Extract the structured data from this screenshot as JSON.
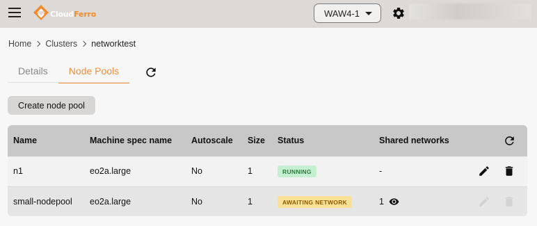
{
  "app": {
    "logo_text_1": "Cloud",
    "logo_text_2": "Ferro",
    "brand_color": "#f28b2c"
  },
  "header": {
    "region": "WAW4-1",
    "menu_icon": "hamburger-menu-icon",
    "settings_icon": "gear-icon"
  },
  "breadcrumb": {
    "items": [
      "Home",
      "Clusters",
      "networktest"
    ]
  },
  "tabs": {
    "items": [
      {
        "label": "Details",
        "active": false
      },
      {
        "label": "Node Pools",
        "active": true
      }
    ],
    "accent": "#f0913a"
  },
  "actions": {
    "create_label": "Create node pool"
  },
  "table": {
    "columns": [
      "Name",
      "Machine spec name",
      "Autoscale",
      "Size",
      "Status",
      "Shared networks"
    ],
    "rows": [
      {
        "name": "n1",
        "machine_spec": "eo2a.large",
        "autoscale": "No",
        "size": "1",
        "status": "RUNNING",
        "status_color": "#c4efd0",
        "shared_networks": "-",
        "actions_enabled": true
      },
      {
        "name": "small-nodepool",
        "machine_spec": "eo2a.large",
        "autoscale": "No",
        "size": "1",
        "status": "AWAITING NETWORK",
        "status_color": "#fbe197",
        "shared_networks": "1",
        "actions_enabled": false
      }
    ]
  }
}
